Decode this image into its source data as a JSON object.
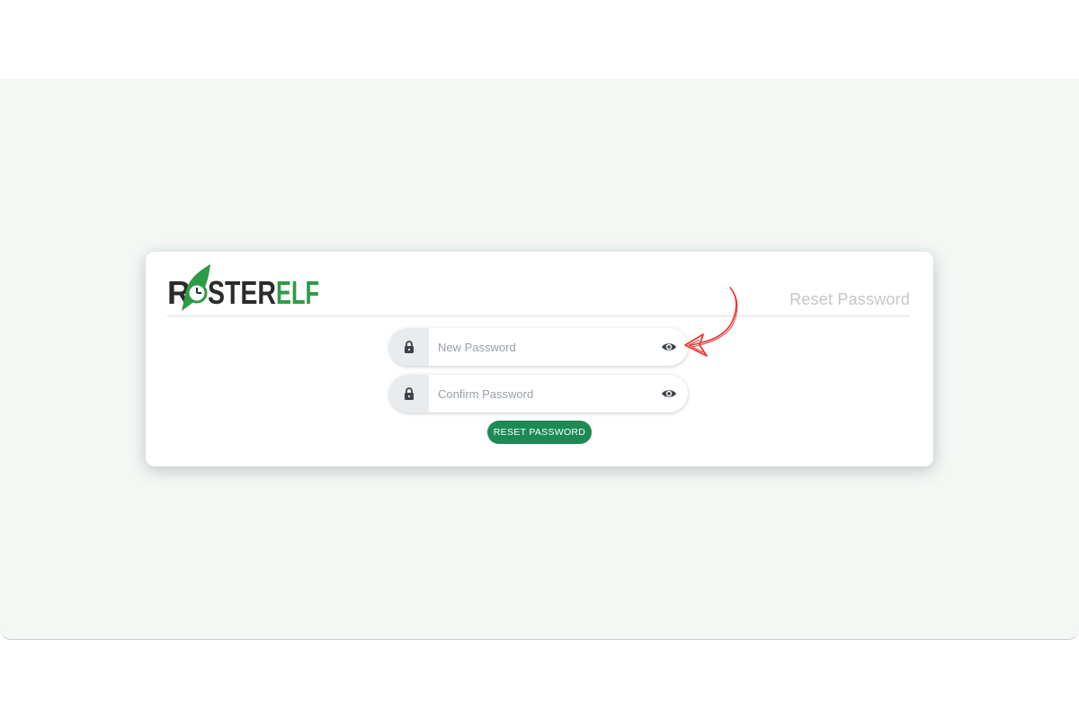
{
  "brand": {
    "logo_text_left": "R",
    "logo_text_mid": "STER",
    "logo_text_right": "ELF",
    "logo_dark_color": "#2b2b2b",
    "logo_green_color": "#2e9b47"
  },
  "card": {
    "heading": "Reset Password"
  },
  "form": {
    "new_password": {
      "value": "",
      "placeholder": "New Password",
      "lock_icon": "lock-icon",
      "toggle_icon": "eye-icon"
    },
    "confirm_password": {
      "value": "",
      "placeholder": "Confirm Password",
      "lock_icon": "lock-icon",
      "toggle_icon": "eye-icon"
    },
    "submit_label": "RESET PASSWORD"
  },
  "annotation": {
    "icon": "hand-drawn-arrow-icon",
    "color": "#e53935"
  },
  "colors": {
    "accent": "#1c8a52",
    "background": "#f3f8f5",
    "heading": "#c3c6c8"
  }
}
